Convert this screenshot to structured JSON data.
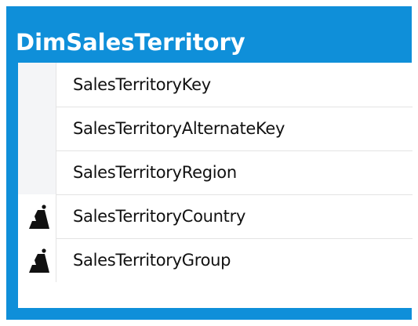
{
  "table": {
    "name": "DimSalesTerritory",
    "columns": [
      {
        "label": "SalesTerritoryKey",
        "icon": "none"
      },
      {
        "label": "SalesTerritoryAlternateKey",
        "icon": "none"
      },
      {
        "label": "SalesTerritoryRegion",
        "icon": "none"
      },
      {
        "label": "SalesTerritoryCountry",
        "icon": "hierarchy-icon"
      },
      {
        "label": "SalesTerritoryGroup",
        "icon": "hierarchy-icon"
      }
    ]
  },
  "colors": {
    "header_blue": "#0f8fd9",
    "key_cell_bg": "#f4f5f7",
    "icon_color": "#111111"
  }
}
